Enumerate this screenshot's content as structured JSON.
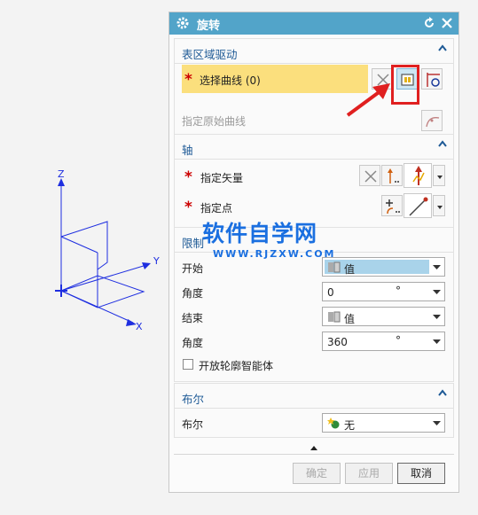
{
  "viewport": {
    "axis_labels": {
      "z": "Z",
      "y": "Y",
      "x": "X"
    }
  },
  "dialog": {
    "title": "旋转",
    "title_icons": [
      "gear-icon",
      "reset-icon",
      "close-icon"
    ],
    "section_surface_drive": {
      "header": "表区域驱动",
      "select_curve_label": "选择曲线 (0)",
      "specify_origin_curve_label": "指定原始曲线"
    },
    "section_axis": {
      "header": "轴",
      "specify_vector_label": "指定矢量",
      "specify_point_label": "指定点"
    },
    "section_limits": {
      "header": "限制",
      "start_label": "开始",
      "start_value": "值",
      "angle1_label": "角度",
      "angle1_value": "0",
      "angle1_unit": "°",
      "end_label": "结束",
      "end_value": "值",
      "angle2_label": "角度",
      "angle2_value": "360",
      "angle2_unit": "°",
      "open_profile_label": "开放轮廓智能体",
      "open_profile_checked": false
    },
    "section_boolean": {
      "header": "布尔",
      "boolean_label": "布尔",
      "boolean_value": "无"
    },
    "buttons": {
      "ok": "确定",
      "apply": "应用",
      "cancel": "取消"
    }
  },
  "watermark": {
    "main": "软件自学网",
    "sub": "WWW.RJZXW.COM"
  },
  "colors": {
    "title_bar": "#52a4c9",
    "selection_highlight": "#fbdf7d",
    "required_star": "#cc0000",
    "axis_lines": "#1e2ee0",
    "watermark": "#1a6fe0",
    "callout": "#e02020"
  }
}
